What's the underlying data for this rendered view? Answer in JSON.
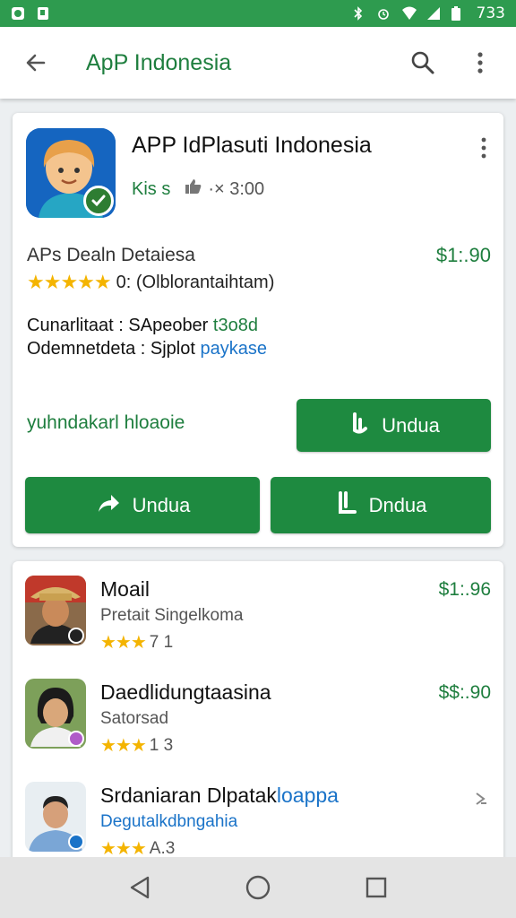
{
  "status_bar": {
    "time": "733"
  },
  "app_bar": {
    "title": "ApP Indonesia"
  },
  "app": {
    "title": "APP IdPlasuti Indonesia",
    "developer": "Kis s",
    "rating_count": "·× 3:00",
    "subtitle": "APs Dealn Detaiesa",
    "price": "$1:.90",
    "stars": "★★★★★",
    "rating_text": "0: (Olblorantaihtam)",
    "info_line_1": {
      "label": "Cunarlitaat : SApeober ",
      "value": "t3o8d"
    },
    "info_line_2": {
      "label": "Odemnetdeta : Sjplot ",
      "value": "paykase"
    },
    "promo": "yuhndakarl hloaoie",
    "button_1": "Undua",
    "button_2": "Undua",
    "button_3": "Dndua"
  },
  "list": [
    {
      "name": "Moail",
      "sub": "Pretait Singelkoma",
      "stars": "★★★",
      "rating": "7 1",
      "price": "$1:.96"
    },
    {
      "name": "Daedlidungtaasina",
      "sub": "Satorsad",
      "stars": "★★★",
      "rating": "1 3",
      "price": "$$:.90"
    },
    {
      "name": "Srdaniaran Dlpatak",
      "name_suffix": "loappa",
      "sub": "Degutalkdbngahia",
      "stars": "★★★",
      "rating": "A.3"
    }
  ],
  "colors": {
    "status": "#2e9b4f",
    "accent": "#1e8a40",
    "star": "#f4b400",
    "link": "#1a73c8"
  },
  "icons": [
    "back-arrow-icon",
    "search-icon",
    "more-vert-icon",
    "thumb-icon",
    "nav-back-icon",
    "nav-home-icon",
    "nav-recents-icon"
  ]
}
